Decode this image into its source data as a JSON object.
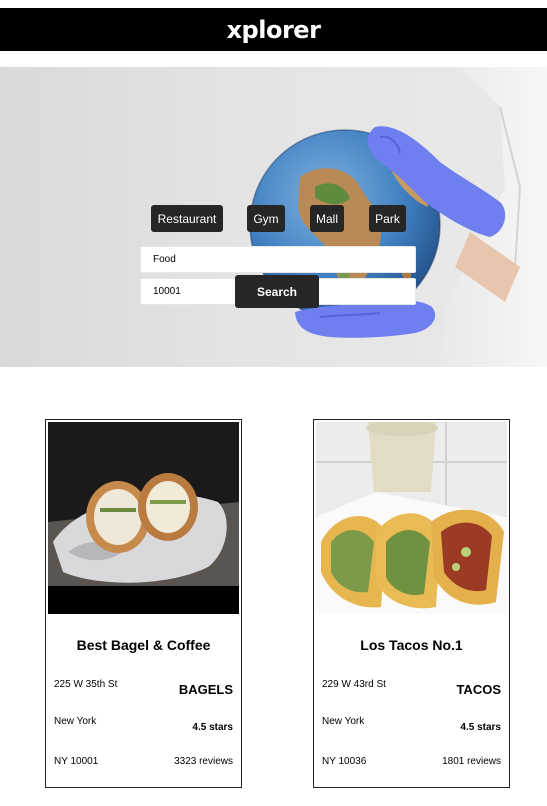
{
  "app": {
    "title": "xplorer"
  },
  "hero": {
    "categories": [
      "Restaurant",
      "Gym",
      "Mall",
      "Park"
    ],
    "query_value": "Food",
    "zip_value": "10001",
    "search_label": "Search"
  },
  "results": [
    {
      "name": "Best Bagel & Coffee",
      "address": "225 W 35th St",
      "city": "New York",
      "zip": "NY 10001",
      "category": "BAGELS",
      "rating": "4.5 stars",
      "reviews": "3323 reviews"
    },
    {
      "name": "Los Tacos No.1",
      "address": "229 W 43rd St",
      "city": "New York",
      "zip": "NY 10036",
      "category": "TACOS",
      "rating": "4.5 stars",
      "reviews": "1801 reviews"
    }
  ]
}
